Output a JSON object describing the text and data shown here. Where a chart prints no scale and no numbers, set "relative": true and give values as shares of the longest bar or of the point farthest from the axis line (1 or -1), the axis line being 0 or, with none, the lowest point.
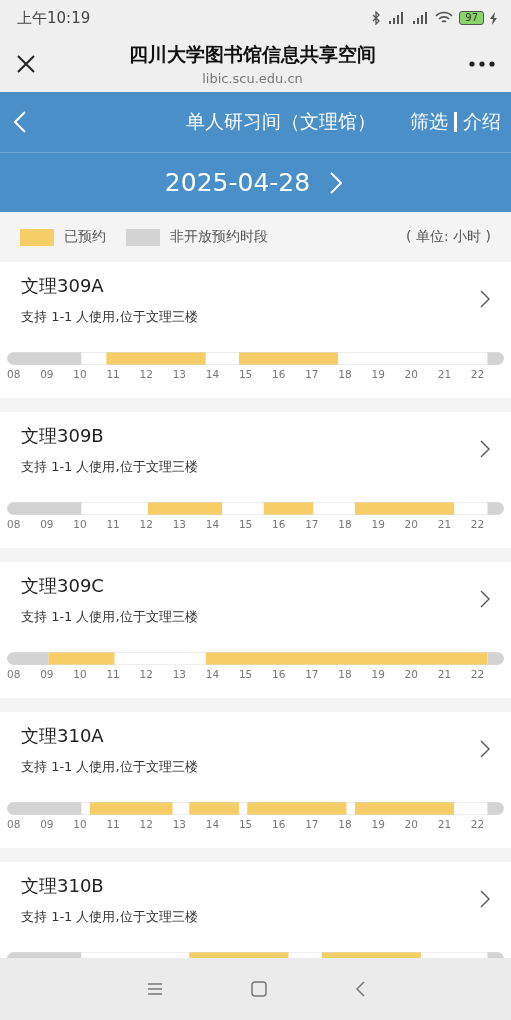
{
  "status_bar": {
    "time": "上午10:19",
    "battery": "97"
  },
  "header": {
    "title": "四川大学图书馆信息共享空间",
    "url": "libic.scu.edu.cn"
  },
  "nav": {
    "title": "单人研习间（文理馆）",
    "actions": [
      "筛选",
      "介绍"
    ]
  },
  "date": "2025-04-28",
  "legend": {
    "items": [
      {
        "kind": "booked",
        "label": "已预约"
      },
      {
        "kind": "closed",
        "label": "非开放预约时段"
      }
    ],
    "unit": "( 单位: 小时 )"
  },
  "rooms": [
    {
      "name": "文理309A",
      "desc": "支持 1-1 人使用,位于文理三楼",
      "chart_data": {
        "type": "bar",
        "orientation": "horizontal",
        "stacked": true,
        "relative": true,
        "series": [
          {
            "color": "#d3d3d3",
            "values": [
              0.15
            ]
          },
          {
            "color": "#ffffff",
            "values": [
              0.05
            ]
          },
          {
            "color": "#f6cd67",
            "values": [
              0.2
            ]
          },
          {
            "color": "#ffffff",
            "values": [
              0.0667
            ]
          },
          {
            "color": "#f6cd67",
            "values": [
              0.2
            ]
          },
          {
            "color": "#ffffff",
            "values": [
              0.3
            ]
          },
          {
            "color": "#d3d3d3",
            "values": [
              0.0333
            ]
          }
        ]
      },
      "hours": [
        "08",
        "09",
        "10",
        "11",
        "12",
        "13",
        "14",
        "15",
        "16",
        "17",
        "18",
        "19",
        "20",
        "21",
        "22"
      ]
    },
    {
      "name": "文理309B",
      "desc": "支持 1-1 人使用,位于文理三楼",
      "chart_data": {
        "type": "bar",
        "orientation": "horizontal",
        "stacked": true,
        "relative": true,
        "series": [
          {
            "color": "#d3d3d3",
            "values": [
              0.15
            ]
          },
          {
            "color": "#ffffff",
            "values": [
              0.1334
            ]
          },
          {
            "color": "#f6cd67",
            "values": [
              0.15
            ]
          },
          {
            "color": "#ffffff",
            "values": [
              0.0833
            ]
          },
          {
            "color": "#f6cd67",
            "values": [
              0.1
            ]
          },
          {
            "color": "#ffffff",
            "values": [
              0.0833
            ]
          },
          {
            "color": "#f6cd67",
            "values": [
              0.2
            ]
          },
          {
            "color": "#ffffff",
            "values": [
              0.0667
            ]
          },
          {
            "color": "#d3d3d3",
            "values": [
              0.0333
            ]
          }
        ]
      },
      "hours": [
        "08",
        "09",
        "10",
        "11",
        "12",
        "13",
        "14",
        "15",
        "16",
        "17",
        "18",
        "19",
        "20",
        "21",
        "22"
      ]
    },
    {
      "name": "文理309C",
      "desc": "支持 1-1 人使用,位于文理三楼",
      "chart_data": {
        "type": "bar",
        "orientation": "horizontal",
        "stacked": true,
        "relative": true,
        "series": [
          {
            "color": "#d3d3d3",
            "values": [
              0.0834
            ]
          },
          {
            "color": "#f6cd67",
            "values": [
              0.1333
            ]
          },
          {
            "color": "#ffffff",
            "values": [
              0.1833
            ]
          },
          {
            "color": "#f6cd67",
            "values": [
              0.5667
            ]
          },
          {
            "color": "#d3d3d3",
            "values": [
              0.0333
            ]
          }
        ]
      },
      "hours": [
        "08",
        "09",
        "10",
        "11",
        "12",
        "13",
        "14",
        "15",
        "16",
        "17",
        "18",
        "19",
        "20",
        "21",
        "22"
      ]
    },
    {
      "name": "文理310A",
      "desc": "支持 1-1 人使用,位于文理三楼",
      "chart_data": {
        "type": "bar",
        "orientation": "horizontal",
        "stacked": true,
        "relative": true,
        "series": [
          {
            "color": "#d3d3d3",
            "values": [
              0.15
            ]
          },
          {
            "color": "#ffffff",
            "values": [
              0.0167
            ]
          },
          {
            "color": "#f6cd67",
            "values": [
              0.1667
            ]
          },
          {
            "color": "#ffffff",
            "values": [
              0.0333
            ]
          },
          {
            "color": "#f6cd67",
            "values": [
              0.1
            ]
          },
          {
            "color": "#ffffff",
            "values": [
              0.0167
            ]
          },
          {
            "color": "#f6cd67",
            "values": [
              0.2
            ]
          },
          {
            "color": "#ffffff",
            "values": [
              0.0167
            ]
          },
          {
            "color": "#f6cd67",
            "values": [
              0.2
            ]
          },
          {
            "color": "#ffffff",
            "values": [
              0.0666
            ]
          },
          {
            "color": "#d3d3d3",
            "values": [
              0.0333
            ]
          }
        ]
      },
      "hours": [
        "08",
        "09",
        "10",
        "11",
        "12",
        "13",
        "14",
        "15",
        "16",
        "17",
        "18",
        "19",
        "20",
        "21",
        "22"
      ]
    },
    {
      "name": "文理310B",
      "desc": "支持 1-1 人使用,位于文理三楼",
      "chart_data": {
        "type": "bar",
        "orientation": "horizontal",
        "stacked": true,
        "relative": true,
        "series": [
          {
            "color": "#d3d3d3",
            "values": [
              0.15
            ]
          },
          {
            "color": "#ffffff",
            "values": [
              0.2167
            ]
          },
          {
            "color": "#f6cd67",
            "values": [
              0.2
            ]
          },
          {
            "color": "#ffffff",
            "values": [
              0.0667
            ]
          },
          {
            "color": "#f6cd67",
            "values": [
              0.2
            ]
          },
          {
            "color": "#ffffff",
            "values": [
              0.1333
            ]
          },
          {
            "color": "#d3d3d3",
            "values": [
              0.0333
            ]
          }
        ]
      }
    }
  ]
}
